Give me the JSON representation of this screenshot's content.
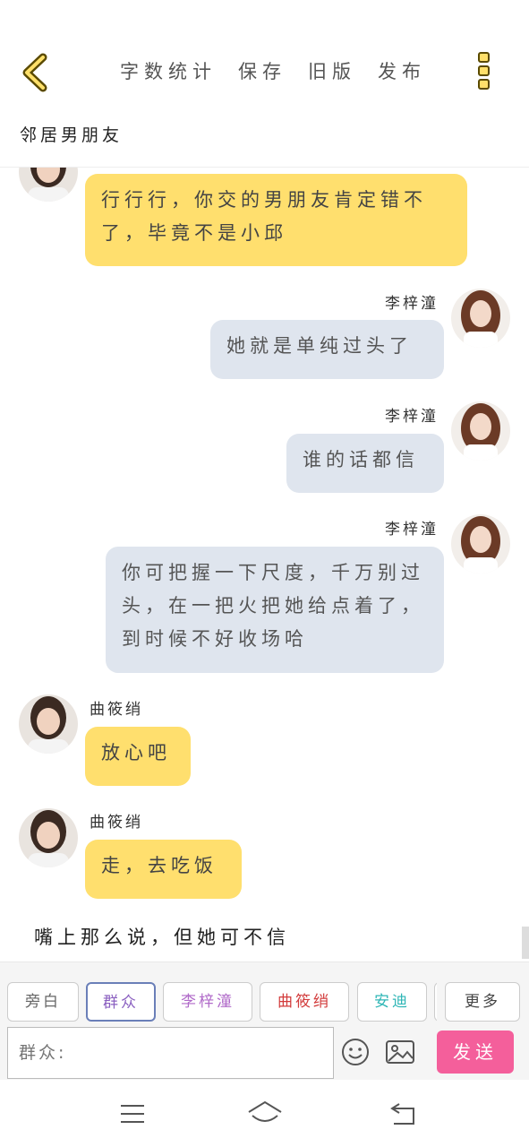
{
  "header": {
    "actions": [
      "字数统计",
      "保存",
      "旧版",
      "发布"
    ],
    "title": "邻居男朋友"
  },
  "messages": [
    {
      "speaker": "",
      "text": "行行行，你交的男朋友肯定错不了，毕竟不是小邱"
    },
    {
      "speaker": "李梓潼",
      "text": "她就是单纯过头了"
    },
    {
      "speaker": "李梓潼",
      "text": "谁的话都信"
    },
    {
      "speaker": "李梓潼",
      "text": "你可把握一下尺度，千万别过头，在一把火把她给点着了，到时候不好收场哈"
    },
    {
      "speaker": "曲筱绡",
      "text": "放心吧"
    },
    {
      "speaker": "曲筱绡",
      "text": "走，去吃饭"
    }
  ],
  "draft_text": "嘴上那么说，但她可不信",
  "toolbar": {
    "chips": [
      {
        "label": "旁白",
        "color": "#666666"
      },
      {
        "label": "群众",
        "color": "#8a5fc0"
      },
      {
        "label": "李梓潼",
        "color": "#b06ac9"
      },
      {
        "label": "曲筱绡",
        "color": "#d23b3b"
      },
      {
        "label": "安迪",
        "color": "#2fb6b6"
      }
    ],
    "more_label": "更多",
    "input_placeholder": "群众:",
    "send_label": "发送",
    "accent": "#f45f9b"
  }
}
